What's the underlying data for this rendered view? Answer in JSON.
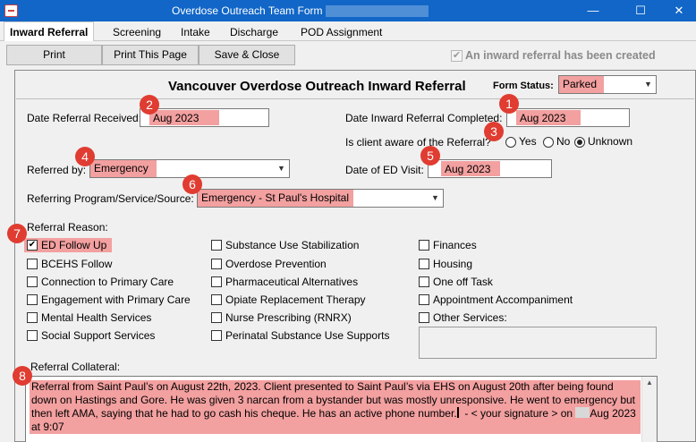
{
  "window": {
    "title": "Overdose Outreach Team Form",
    "minimize": "—",
    "maximize": "☐",
    "close": "✕"
  },
  "tabs": [
    "Inward Referral",
    "Screening",
    "Intake",
    "Discharge",
    "POD Assignment"
  ],
  "toolbar": {
    "print": "Print",
    "print_page": "Print This Page",
    "save_close": "Save & Close",
    "created_check": "✔",
    "created_label": "An inward referral has been created"
  },
  "form": {
    "heading": "Vancouver Overdose Outreach Inward Referral",
    "status_label": "Form Status:",
    "status_value": "Parked",
    "date_received_label": "Date Referral Received:",
    "date_received_value": "Aug 2023",
    "date_completed_label": "Date Inward Referral Completed:",
    "date_completed_value": "Aug 2023",
    "aware_label": "Is client aware of the Referral?",
    "aware_options": [
      "Yes",
      "No",
      "Unknown"
    ],
    "referred_by_label": "Referred by:",
    "referred_by_value": "Emergency",
    "ed_visit_label": "Date of ED Visit:",
    "ed_visit_value": "Aug 2023",
    "program_label": "Referring Program/Service/Source:",
    "program_value": "Emergency - St Paul's Hospital",
    "reason_label": "Referral Reason:",
    "reasons_col1": [
      "ED Follow Up",
      "BCEHS Follow",
      "Connection to Primary Care",
      "Engagement with Primary Care",
      "Mental Health Services",
      "Social Support Services"
    ],
    "reasons_col2": [
      "Substance Use Stabilization",
      "Overdose Prevention",
      "Pharmaceutical Alternatives",
      "Opiate Replacement Therapy",
      "Nurse Prescribing (RNRX)",
      "Perinatal Substance Use Supports"
    ],
    "reasons_col3": [
      "Finances",
      "Housing",
      "One off Task",
      "Appointment Accompaniment",
      "Other Services:"
    ],
    "checked_mark": "✔",
    "collateral_label": "Referral Collateral:",
    "collateral_text_1": "Referral from Saint Paul’s on August 22th, 2023. Client presented to Saint Paul’s via EHS on August 20th after being found down on Hastings and Gore.  He was given 3 narcan from a bystander but was mostly unresponsive.  He went to emergency but then left AMA, saying that he had to go cash his cheque.  He has an active phone number.",
    "collateral_text_2": "- < your signature > on",
    "collateral_text_3": "Aug 2023 at 9:07"
  },
  "badges": [
    "1",
    "2",
    "3",
    "4",
    "5",
    "6",
    "7",
    "8"
  ],
  "colors": {
    "titlebar": "#1166c7",
    "highlight": "#f3a0a0",
    "badge": "#e03c31"
  }
}
